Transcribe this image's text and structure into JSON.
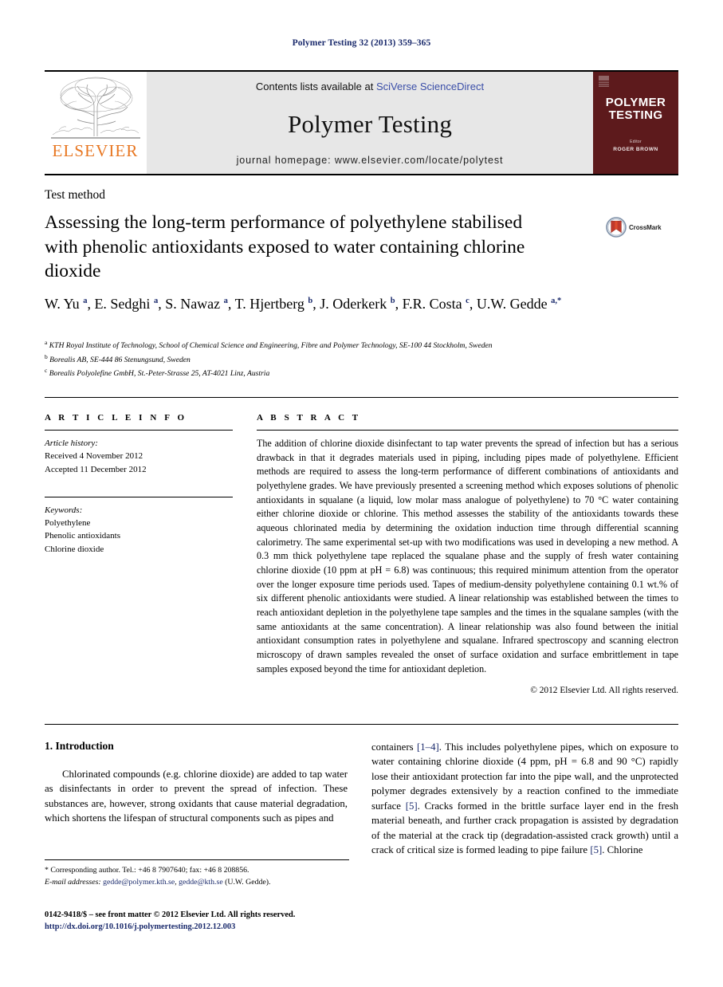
{
  "running_head": "Polymer Testing 32 (2013) 359–365",
  "masthead": {
    "publisher_name": "ELSEVIER",
    "contents_prefix": "Contents lists available at ",
    "contents_link": "SciVerse ScienceDirect",
    "journal_name": "Polymer Testing",
    "homepage_line": "journal homepage: www.elsevier.com/locate/polytest",
    "cover": {
      "title_line1": "POLYMER",
      "title_line2": "TESTING",
      "editor_label": "Editor",
      "editor_name": "ROGER BROWN",
      "background_color": "#5d1a1c"
    }
  },
  "article": {
    "type": "Test method",
    "title": "Assessing the long-term performance of polyethylene stabilised with phenolic antioxidants exposed to water containing chlorine dioxide",
    "crossmark_label": "CrossMark",
    "authors_html": "W. Yu <sup>a</sup>, E. Sedghi <sup>a</sup>, S. Nawaz <sup>a</sup>, T. Hjertberg <sup>b</sup>, J. Oderkerk <sup>b</sup>, F.R. Costa <sup>c</sup>, U.W. Gedde <sup>a,*</sup>",
    "affiliations": [
      {
        "marker": "a",
        "text": "KTH Royal Institute of Technology, School of Chemical Science and Engineering, Fibre and Polymer Technology, SE-100 44 Stockholm, Sweden"
      },
      {
        "marker": "b",
        "text": "Borealis AB, SE-444 86 Stenungsund, Sweden"
      },
      {
        "marker": "c",
        "text": "Borealis Polyolefine GmbH, St.-Peter-Strasse 25, AT-4021 Linz, Austria"
      }
    ]
  },
  "article_info": {
    "heading": "A R T I C L E  I N F O",
    "history_label": "Article history:",
    "received": "Received 4 November 2012",
    "accepted": "Accepted 11 December 2012",
    "keywords_label": "Keywords:",
    "keywords": [
      "Polyethylene",
      "Phenolic antioxidants",
      "Chlorine dioxide"
    ]
  },
  "abstract": {
    "heading": "A B S T R A C T",
    "text": "The addition of chlorine dioxide disinfectant to tap water prevents the spread of infection but has a serious drawback in that it degrades materials used in piping, including pipes made of polyethylene. Efficient methods are required to assess the long-term performance of different combinations of antioxidants and polyethylene grades. We have previously presented a screening method which exposes solutions of phenolic antioxidants in squalane (a liquid, low molar mass analogue of polyethylene) to 70 °C water containing either chlorine dioxide or chlorine. This method assesses the stability of the antioxidants towards these aqueous chlorinated media by determining the oxidation induction time through differential scanning calorimetry. The same experimental set-up with two modifications was used in developing a new method. A 0.3 mm thick polyethylene tape replaced the squalane phase and the supply of fresh water containing chlorine dioxide (10 ppm at pH = 6.8) was continuous; this required minimum attention from the operator over the longer exposure time periods used. Tapes of medium-density polyethylene containing 0.1 wt.% of six different phenolic antioxidants were studied. A linear relationship was established between the times to reach antioxidant depletion in the polyethylene tape samples and the times in the squalane samples (with the same antioxidants at the same concentration). A linear relationship was also found between the initial antioxidant consumption rates in polyethylene and squalane. Infrared spectroscopy and scanning electron microscopy of drawn samples revealed the onset of surface oxidation and surface embrittlement in tape samples exposed beyond the time for antioxidant depletion.",
    "copyright": "© 2012 Elsevier Ltd. All rights reserved."
  },
  "body": {
    "section_number_title": "1. Introduction",
    "left_paragraph": "Chlorinated compounds (e.g. chlorine dioxide) are added to tap water as disinfectants in order to prevent the spread of infection. These substances are, however, strong oxidants that cause material degradation, which shortens the lifespan of structural components such as pipes and",
    "right_paragraph_html": "containers <span class=\"ref\">[1–4]</span>. This includes polyethylene pipes, which on exposure to water containing chlorine dioxide (4 ppm, pH = 6.8 and 90 °C) rapidly lose their antioxidant protection far into the pipe wall, and the unprotected polymer degrades extensively by a reaction confined to the immediate surface <span class=\"ref\">[5]</span>. Cracks formed in the brittle surface layer end in the fresh material beneath, and further crack propagation is assisted by degradation of the material at the crack tip (degradation-assisted crack growth) until a crack of critical size is formed leading to pipe failure <span class=\"ref\">[5]</span>. Chlorine"
  },
  "footer": {
    "corresponding_note": "* Corresponding author. Tel.: +46 8 7907640; fax: +46 8 208856.",
    "email_label": "E-mail addresses:",
    "email_1": "gedde@polymer.kth.se",
    "email_2": "gedde@kth.se",
    "email_suffix": "(U.W. Gedde).",
    "issn_line": "0142-9418/$ – see front matter © 2012 Elsevier Ltd. All rights reserved.",
    "doi": "http://dx.doi.org/10.1016/j.polymertesting.2012.12.003"
  }
}
